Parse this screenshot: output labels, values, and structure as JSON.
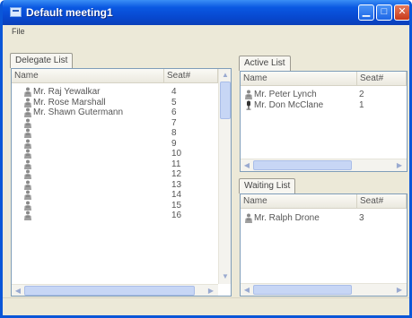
{
  "window": {
    "title": "Default meeting1"
  },
  "menu": {
    "file": "File"
  },
  "delegate": {
    "tab": "Delegate List",
    "col_name": "Name",
    "col_seat": "Seat#",
    "rows": [
      {
        "name": "Mr. Raj Yewalkar",
        "seat": "4"
      },
      {
        "name": "Mr. Rose Marshall",
        "seat": "5"
      },
      {
        "name": "Mr. Shawn Gutermann",
        "seat": "6"
      },
      {
        "name": "",
        "seat": "7"
      },
      {
        "name": "",
        "seat": "8"
      },
      {
        "name": "",
        "seat": "9"
      },
      {
        "name": "",
        "seat": "10"
      },
      {
        "name": "",
        "seat": "11"
      },
      {
        "name": "",
        "seat": "12"
      },
      {
        "name": "",
        "seat": "13"
      },
      {
        "name": "",
        "seat": "14"
      },
      {
        "name": "",
        "seat": "15"
      },
      {
        "name": "",
        "seat": "16"
      }
    ]
  },
  "active": {
    "tab": "Active List",
    "col_name": "Name",
    "col_seat": "Seat#",
    "rows": [
      {
        "name": "Mr. Peter Lynch",
        "seat": "2"
      },
      {
        "name": "Mr. Don McClane",
        "seat": "1"
      }
    ]
  },
  "waiting": {
    "tab": "Waiting List",
    "col_name": "Name",
    "col_seat": "Seat#",
    "rows": [
      {
        "name": "Mr. Ralph Drone",
        "seat": "3"
      }
    ]
  },
  "icons": {
    "app": "meeting-app-icon",
    "person": "person-icon",
    "speaker": "microphone-icon"
  },
  "colors": {
    "titlebar": "#0a58e2",
    "close": "#c8391a",
    "scroll_thumb": "#c7d6f5"
  }
}
